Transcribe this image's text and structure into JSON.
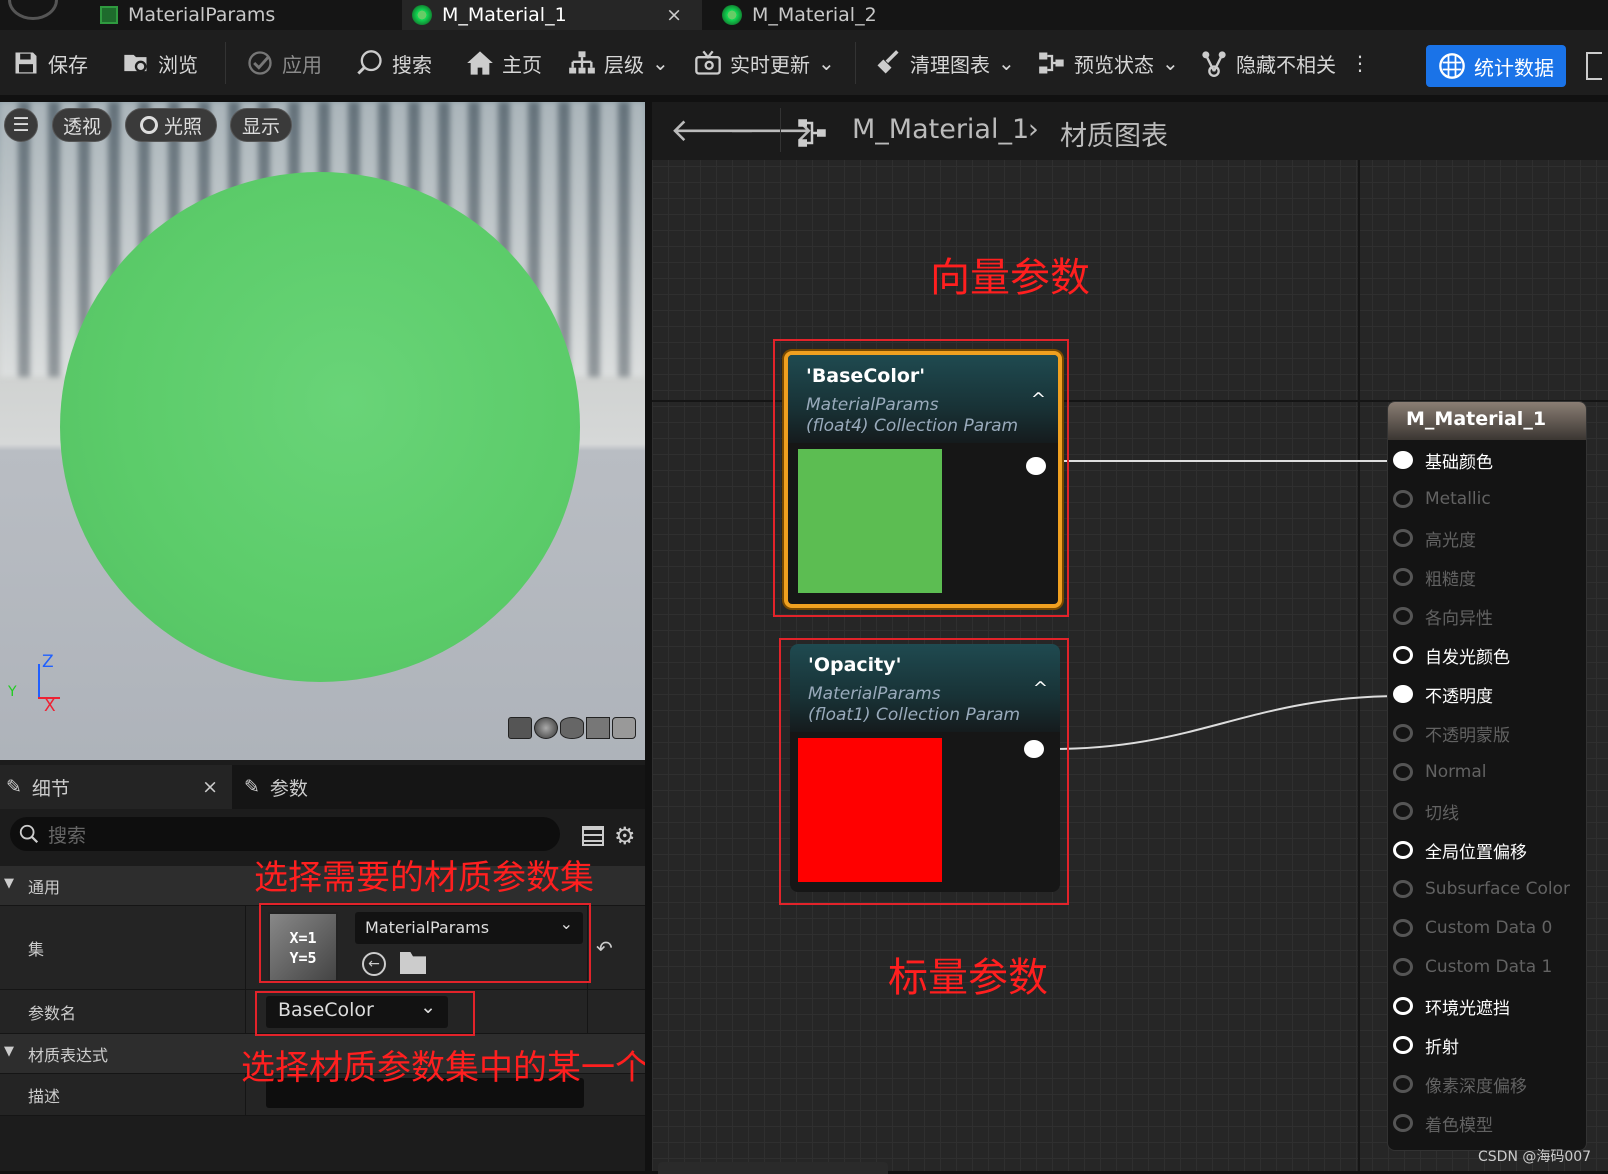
{
  "tabs": [
    {
      "label": "MaterialParams",
      "active": false,
      "icon": "material-param-collection-icon"
    },
    {
      "label": "M_Material_1",
      "active": true,
      "icon": "material-icon",
      "close": "×"
    },
    {
      "label": "M_Material_2",
      "active": false,
      "icon": "material-icon"
    }
  ],
  "toolbar": {
    "save": "保存",
    "browse": "浏览",
    "apply": "应用",
    "search": "搜索",
    "home": "主页",
    "hierarchy": "层级",
    "live_update": "实时更新",
    "clean_graph": "清理图表",
    "preview_state": "预览状态",
    "hide_unrelated": "隐藏不相关",
    "stats": "统计数据"
  },
  "viewport": {
    "perspective": "透视",
    "lighting": "光照",
    "show": "显示",
    "axis_z": "Z",
    "axis_x": "X",
    "axis_y": "Y",
    "sphere_color": "#5ccc6a"
  },
  "details": {
    "tab_details": "细节",
    "tab_params": "参数",
    "close": "×",
    "search_placeholder": "搜索",
    "section_general": "通用",
    "collection_label": "集",
    "collection_value": "MaterialParams",
    "icon_text_x": "X=1",
    "icon_text_y": "Y=5",
    "param_name_label": "参数名",
    "param_name_value": "BaseColor",
    "section_expression": "材质表达式",
    "description_label": "描述"
  },
  "annotations": {
    "choose_collection": "选择需要的材质参数集",
    "choose_param": "选择材质参数集中的某一个参数",
    "vector_param": "向量参数",
    "scalar_param": "标量参数"
  },
  "graph": {
    "breadcrumb_material": "M_Material_1",
    "breadcrumb_graph": "材质图表",
    "node_basecolor": {
      "title": "'BaseColor'",
      "sub1": "MaterialParams",
      "sub2": "(float4) Collection Param",
      "swatch": "#5cbd52"
    },
    "node_opacity": {
      "title": "'Opacity'",
      "sub1": "MaterialParams",
      "sub2": "(float1) Collection Param",
      "swatch": "#ff0000"
    },
    "result_node": {
      "title": "M_Material_1",
      "pins": [
        {
          "label": "基础颜色",
          "enabled": true,
          "connected": true
        },
        {
          "label": "Metallic",
          "enabled": false,
          "connected": false
        },
        {
          "label": "高光度",
          "enabled": false,
          "connected": false
        },
        {
          "label": "粗糙度",
          "enabled": false,
          "connected": false
        },
        {
          "label": "各向异性",
          "enabled": false,
          "connected": false
        },
        {
          "label": "自发光颜色",
          "enabled": true,
          "connected": false
        },
        {
          "label": "不透明度",
          "enabled": true,
          "connected": true
        },
        {
          "label": "不透明蒙版",
          "enabled": false,
          "connected": false
        },
        {
          "label": "Normal",
          "enabled": false,
          "connected": false
        },
        {
          "label": "切线",
          "enabled": false,
          "connected": false
        },
        {
          "label": "全局位置偏移",
          "enabled": true,
          "connected": false
        },
        {
          "label": "Subsurface Color",
          "enabled": false,
          "connected": false
        },
        {
          "label": "Custom Data 0",
          "enabled": false,
          "connected": false
        },
        {
          "label": "Custom Data 1",
          "enabled": false,
          "connected": false
        },
        {
          "label": "环境光遮挡",
          "enabled": true,
          "connected": false
        },
        {
          "label": "折射",
          "enabled": true,
          "connected": false
        },
        {
          "label": "像素深度偏移",
          "enabled": false,
          "connected": false
        },
        {
          "label": "着色模型",
          "enabled": false,
          "connected": false
        }
      ]
    }
  },
  "watermark": "CSDN @海码007"
}
